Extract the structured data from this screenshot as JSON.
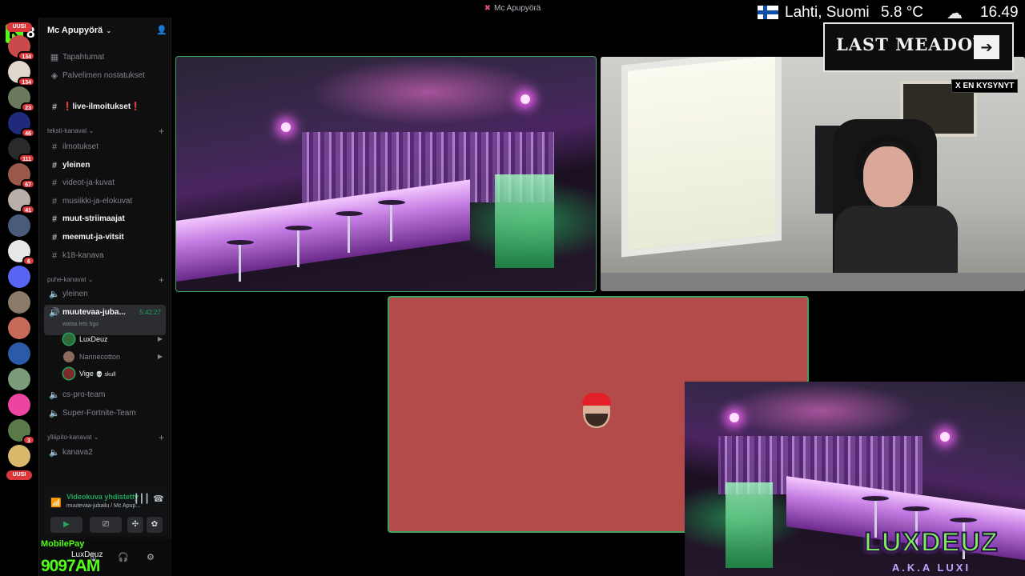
{
  "window": {
    "title": "Mc Apupyörä"
  },
  "kick": {
    "logo": "K",
    "count": "8"
  },
  "rail": {
    "new_label_top": "UUSI",
    "new_label_bottom": "UUSI",
    "servers": [
      {
        "badge": "134",
        "color": "#c94a4a"
      },
      {
        "badge": "134",
        "color": "#e0d8cc"
      },
      {
        "badge": "23",
        "color": "#6b7a5e"
      },
      {
        "badge": "46",
        "color": "#1f2a7a"
      },
      {
        "badge": "111",
        "color": "#2a2a2a"
      },
      {
        "badge": "67",
        "color": "#9a5a4a"
      },
      {
        "badge": "41",
        "color": "#b8b0a8"
      },
      {
        "badge": "",
        "color": "#4a5a7a"
      },
      {
        "badge": "6",
        "color": "#e8e8e8"
      },
      {
        "badge": "",
        "color": "#5865f2"
      },
      {
        "badge": "",
        "color": "#8a7a6a"
      },
      {
        "badge": "",
        "color": "#c86a5a"
      },
      {
        "badge": "",
        "color": "#2a5aa8"
      },
      {
        "badge": "",
        "color": "#7a9a7a"
      },
      {
        "badge": "",
        "color": "#eb459f"
      },
      {
        "badge": "3",
        "color": "#5a7a4a"
      },
      {
        "badge": "",
        "color": "#d8b86a"
      }
    ]
  },
  "server": {
    "name": "Mc Apupyörä"
  },
  "sidebar": {
    "events": "Tapahtumat",
    "boosts": "Palvelimen nostatukset",
    "announce": "❗live-ilmoitukset❗",
    "text_category": "teksti-kanavat",
    "text_channels": [
      {
        "name": "ilmotukset",
        "unread": false
      },
      {
        "name": "yleinen",
        "unread": true
      },
      {
        "name": "videot-ja-kuvat",
        "unread": false
      },
      {
        "name": "musiikki-ja-elokuvat",
        "unread": false
      },
      {
        "name": "muut-striimaajat",
        "unread": true
      },
      {
        "name": "meemut-ja-vitsit",
        "unread": true
      },
      {
        "name": "k18-kanava",
        "unread": false
      }
    ],
    "voice_category": "puhe-kanavat",
    "voice_channels": {
      "yleinen": "yleinen",
      "active": "muutevaa-juba...",
      "active_timer": "5:42:27",
      "active_status": "wataa lets hgo",
      "users": [
        {
          "name": "LuxDeuz",
          "speaking": true,
          "status": ""
        },
        {
          "name": "Nannecotton",
          "speaking": false,
          "status": ""
        },
        {
          "name": "Vige",
          "speaking": true,
          "status": "💀 skull"
        }
      ],
      "cs": "cs-pro-team",
      "fortnite": "Super-Fortnite-Team"
    },
    "admin_category": "ylläpito-kanavat",
    "admin_channel": "kanava2"
  },
  "voice_panel": {
    "title": "Videokuva yhdistetty",
    "subtitle": "muutevaa-jubailu / Mc Apup..."
  },
  "user_panel": {
    "mobilepay": "MobilePay",
    "username": "LuxDeuz",
    "counter": "9097AM"
  },
  "overlay": {
    "location": "Lahti, Suomi",
    "temperature": "5.8 °C",
    "time": "16.49",
    "game_title": "LAST MEADOW",
    "game_arrow": "➔",
    "asked": "X EN KYSYNYT",
    "brand": "LUXDEUZ",
    "brand_sub": "A.K.A LUXI"
  }
}
